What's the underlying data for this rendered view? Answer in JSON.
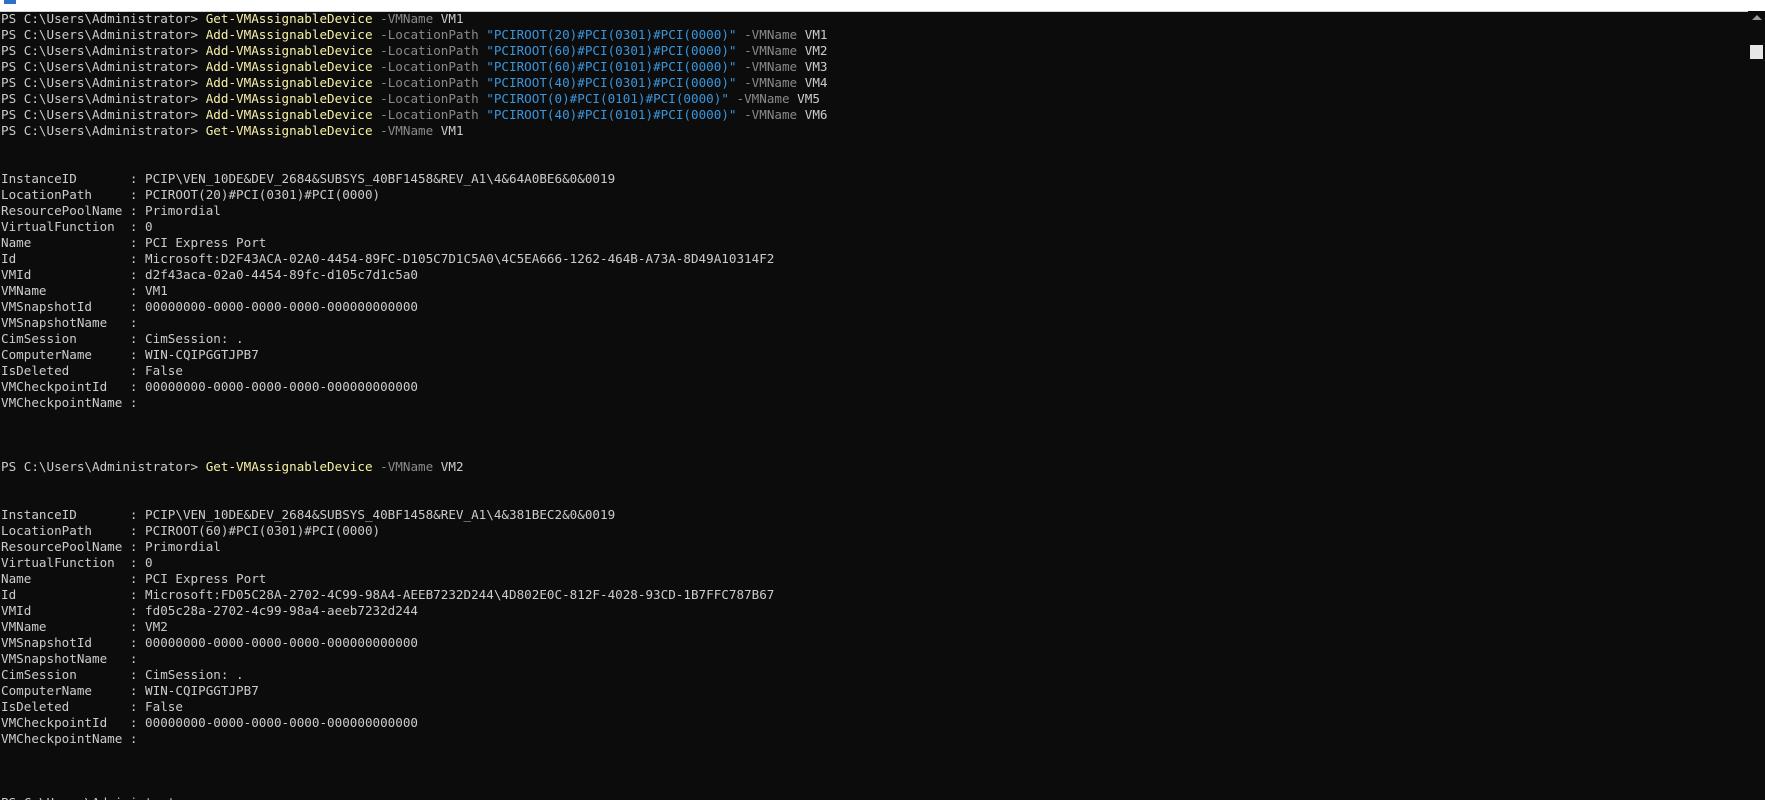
{
  "window": {
    "icon": "powershell-icon"
  },
  "console": {
    "lines": [
      {
        "segments": [
          {
            "t": "PS C:\\Users\\Administrator> "
          },
          {
            "t": "Get-VMAssignableDevice",
            "c": "cmd"
          },
          {
            "t": " -VMName",
            "c": "param"
          },
          {
            "t": " VM1"
          }
        ]
      },
      {
        "segments": [
          {
            "t": "PS C:\\Users\\Administrator> "
          },
          {
            "t": "Add-VMAssignableDevice",
            "c": "cmd"
          },
          {
            "t": " -LocationPath",
            "c": "param"
          },
          {
            "t": " \"PCIROOT(20)#PCI(0301)#PCI(0000)\"",
            "c": "str"
          },
          {
            "t": " -VMName",
            "c": "param"
          },
          {
            "t": " VM1"
          }
        ]
      },
      {
        "segments": [
          {
            "t": "PS C:\\Users\\Administrator> "
          },
          {
            "t": "Add-VMAssignableDevice",
            "c": "cmd"
          },
          {
            "t": " -LocationPath",
            "c": "param"
          },
          {
            "t": " \"PCIROOT(60)#PCI(0301)#PCI(0000)\"",
            "c": "str"
          },
          {
            "t": " -VMName",
            "c": "param"
          },
          {
            "t": " VM2"
          }
        ]
      },
      {
        "segments": [
          {
            "t": "PS C:\\Users\\Administrator> "
          },
          {
            "t": "Add-VMAssignableDevice",
            "c": "cmd"
          },
          {
            "t": " -LocationPath",
            "c": "param"
          },
          {
            "t": " \"PCIROOT(60)#PCI(0101)#PCI(0000)\"",
            "c": "str"
          },
          {
            "t": " -VMName",
            "c": "param"
          },
          {
            "t": " VM3"
          }
        ]
      },
      {
        "segments": [
          {
            "t": "PS C:\\Users\\Administrator> "
          },
          {
            "t": "Add-VMAssignableDevice",
            "c": "cmd"
          },
          {
            "t": " -LocationPath",
            "c": "param"
          },
          {
            "t": " \"PCIROOT(40)#PCI(0301)#PCI(0000)\"",
            "c": "str"
          },
          {
            "t": " -VMName",
            "c": "param"
          },
          {
            "t": " VM4"
          }
        ]
      },
      {
        "segments": [
          {
            "t": "PS C:\\Users\\Administrator> "
          },
          {
            "t": "Add-VMAssignableDevice",
            "c": "cmd"
          },
          {
            "t": " -LocationPath",
            "c": "param"
          },
          {
            "t": " \"PCIROOT(0)#PCI(0101)#PCI(0000)\"",
            "c": "str"
          },
          {
            "t": " -VMName",
            "c": "param"
          },
          {
            "t": " VM5"
          }
        ]
      },
      {
        "segments": [
          {
            "t": "PS C:\\Users\\Administrator> "
          },
          {
            "t": "Add-VMAssignableDevice",
            "c": "cmd"
          },
          {
            "t": " -LocationPath",
            "c": "param"
          },
          {
            "t": " \"PCIROOT(40)#PCI(0101)#PCI(0000)\"",
            "c": "str"
          },
          {
            "t": " -VMName",
            "c": "param"
          },
          {
            "t": " VM6"
          }
        ]
      },
      {
        "segments": [
          {
            "t": "PS C:\\Users\\Administrator> "
          },
          {
            "t": "Get-VMAssignableDevice",
            "c": "cmd"
          },
          {
            "t": " -VMName",
            "c": "param"
          },
          {
            "t": " VM1"
          }
        ]
      },
      {
        "segments": []
      },
      {
        "segments": []
      },
      {
        "segments": [
          {
            "t": "InstanceID       : PCIP\\VEN_10DE&DEV_2684&SUBSYS_40BF1458&REV_A1\\4&64A0BE6&0&0019"
          }
        ]
      },
      {
        "segments": [
          {
            "t": "LocationPath     : PCIROOT(20)#PCI(0301)#PCI(0000)"
          }
        ]
      },
      {
        "segments": [
          {
            "t": "ResourcePoolName : Primordial"
          }
        ]
      },
      {
        "segments": [
          {
            "t": "VirtualFunction  : 0"
          }
        ]
      },
      {
        "segments": [
          {
            "t": "Name             : PCI Express Port"
          }
        ]
      },
      {
        "segments": [
          {
            "t": "Id               : Microsoft:D2F43ACA-02A0-4454-89FC-D105C7D1C5A0\\4C5EA666-1262-464B-A73A-8D49A10314F2"
          }
        ]
      },
      {
        "segments": [
          {
            "t": "VMId             : d2f43aca-02a0-4454-89fc-d105c7d1c5a0"
          }
        ]
      },
      {
        "segments": [
          {
            "t": "VMName           : VM1"
          }
        ]
      },
      {
        "segments": [
          {
            "t": "VMSnapshotId     : 00000000-0000-0000-0000-000000000000"
          }
        ]
      },
      {
        "segments": [
          {
            "t": "VMSnapshotName   :"
          }
        ]
      },
      {
        "segments": [
          {
            "t": "CimSession       : CimSession: ."
          }
        ]
      },
      {
        "segments": [
          {
            "t": "ComputerName     : WIN-CQIPGGTJPB7"
          }
        ]
      },
      {
        "segments": [
          {
            "t": "IsDeleted        : False"
          }
        ]
      },
      {
        "segments": [
          {
            "t": "VMCheckpointId   : 00000000-0000-0000-0000-000000000000"
          }
        ]
      },
      {
        "segments": [
          {
            "t": "VMCheckpointName :"
          }
        ]
      },
      {
        "segments": []
      },
      {
        "segments": []
      },
      {
        "segments": []
      },
      {
        "segments": [
          {
            "t": "PS C:\\Users\\Administrator> "
          },
          {
            "t": "Get-VMAssignableDevice",
            "c": "cmd"
          },
          {
            "t": " -VMName",
            "c": "param"
          },
          {
            "t": " VM2"
          }
        ]
      },
      {
        "segments": []
      },
      {
        "segments": []
      },
      {
        "segments": [
          {
            "t": "InstanceID       : PCIP\\VEN_10DE&DEV_2684&SUBSYS_40BF1458&REV_A1\\4&381BEC2&0&0019"
          }
        ]
      },
      {
        "segments": [
          {
            "t": "LocationPath     : PCIROOT(60)#PCI(0301)#PCI(0000)"
          }
        ]
      },
      {
        "segments": [
          {
            "t": "ResourcePoolName : Primordial"
          }
        ]
      },
      {
        "segments": [
          {
            "t": "VirtualFunction  : 0"
          }
        ]
      },
      {
        "segments": [
          {
            "t": "Name             : PCI Express Port"
          }
        ]
      },
      {
        "segments": [
          {
            "t": "Id               : Microsoft:FD05C28A-2702-4C99-98A4-AEEB7232D244\\4D802E0C-812F-4028-93CD-1B7FFC787B67"
          }
        ]
      },
      {
        "segments": [
          {
            "t": "VMId             : fd05c28a-2702-4c99-98a4-aeeb7232d244"
          }
        ]
      },
      {
        "segments": [
          {
            "t": "VMName           : VM2"
          }
        ]
      },
      {
        "segments": [
          {
            "t": "VMSnapshotId     : 00000000-0000-0000-0000-000000000000"
          }
        ]
      },
      {
        "segments": [
          {
            "t": "VMSnapshotName   :"
          }
        ]
      },
      {
        "segments": [
          {
            "t": "CimSession       : CimSession: ."
          }
        ]
      },
      {
        "segments": [
          {
            "t": "ComputerName     : WIN-CQIPGGTJPB7"
          }
        ]
      },
      {
        "segments": [
          {
            "t": "IsDeleted        : False"
          }
        ]
      },
      {
        "segments": [
          {
            "t": "VMCheckpointId   : 00000000-0000-0000-0000-000000000000"
          }
        ]
      },
      {
        "segments": [
          {
            "t": "VMCheckpointName :"
          }
        ]
      },
      {
        "segments": []
      },
      {
        "segments": []
      },
      {
        "segments": []
      },
      {
        "segments": [
          {
            "t": "PS C:\\Users\\Administrator> "
          }
        ]
      }
    ]
  },
  "colors": {
    "background": "#0c0c0c",
    "text": "#cccccc",
    "command": "#f9f1a5",
    "parameter": "#8a8a8a",
    "string": "#3a96dd"
  }
}
